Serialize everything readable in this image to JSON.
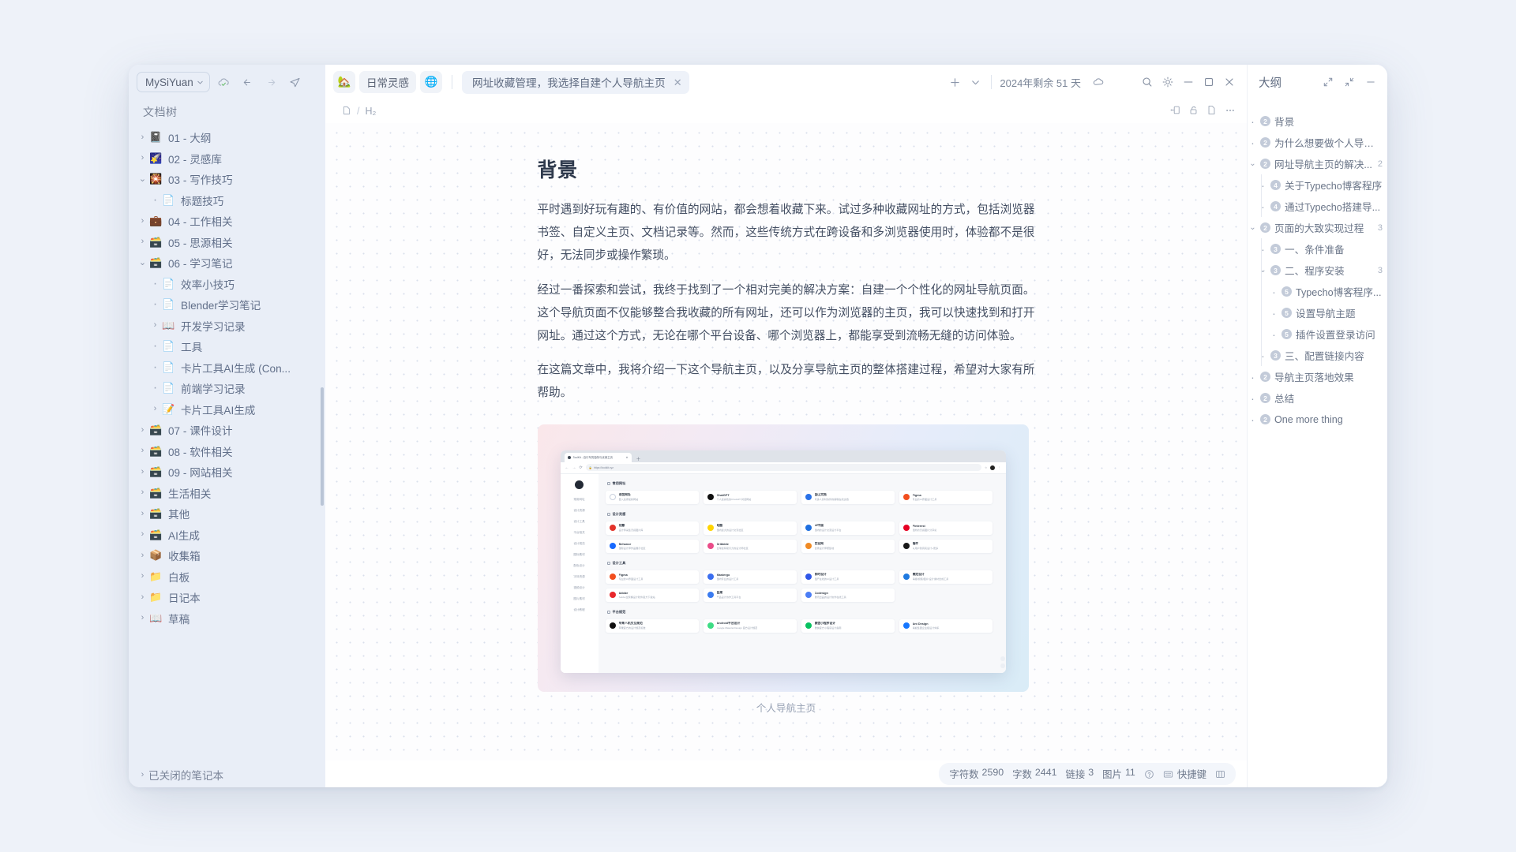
{
  "sidebar": {
    "workspace": {
      "label": "MySiYuan",
      "chevron": "chevron-down-icon"
    },
    "toolbar_icons": [
      "cloud-sync-icon",
      "back-arrow-icon",
      "forward-arrow-icon",
      "send-plane-icon"
    ],
    "section_title": "文档树",
    "items": [
      {
        "label": "01 - 大纲",
        "emoji": "📓",
        "twisty": "collapsed",
        "indent": 0
      },
      {
        "label": "02 - 灵感库",
        "emoji": "🌠",
        "twisty": "collapsed",
        "indent": 0
      },
      {
        "label": "03 - 写作技巧",
        "emoji": "🎇",
        "twisty": "expanded",
        "indent": 0
      },
      {
        "label": "标题技巧",
        "emoji": "📄",
        "twisty": "dot",
        "indent": 1
      },
      {
        "label": "04 - 工作相关",
        "emoji": "💼",
        "twisty": "collapsed",
        "indent": 0
      },
      {
        "label": "05 - 思源相关",
        "emoji": "🗃️",
        "twisty": "collapsed",
        "indent": 0
      },
      {
        "label": "06 - 学习笔记",
        "emoji": "🗃️",
        "twisty": "expanded",
        "indent": 0
      },
      {
        "label": "效率小技巧",
        "emoji": "📄",
        "twisty": "dot",
        "indent": 1
      },
      {
        "label": "Blender学习笔记",
        "emoji": "📄",
        "twisty": "dot",
        "indent": 1
      },
      {
        "label": "开发学习记录",
        "emoji": "📖",
        "twisty": "collapsed",
        "indent": 1
      },
      {
        "label": "工具",
        "emoji": "📄",
        "twisty": "dot",
        "indent": 1
      },
      {
        "label": "卡片工具AI生成 (Con...",
        "emoji": "📄",
        "twisty": "dot",
        "indent": 1
      },
      {
        "label": "前端学习记录",
        "emoji": "📄",
        "twisty": "dot",
        "indent": 1
      },
      {
        "label": "卡片工具AI生成",
        "emoji": "📝",
        "twisty": "collapsed",
        "indent": 1
      },
      {
        "label": "07 - 课件设计",
        "emoji": "🗃️",
        "twisty": "collapsed",
        "indent": 0
      },
      {
        "label": "08 - 软件相关",
        "emoji": "🗃️",
        "twisty": "collapsed",
        "indent": 0
      },
      {
        "label": "09 - 网站相关",
        "emoji": "🗃️",
        "twisty": "collapsed",
        "indent": 0
      },
      {
        "label": "生活相关",
        "emoji": "🗃️",
        "twisty": "collapsed",
        "indent": 0
      },
      {
        "label": "其他",
        "emoji": "🗃️",
        "twisty": "collapsed",
        "indent": 0
      },
      {
        "label": "AI生成",
        "emoji": "🗃️",
        "twisty": "collapsed",
        "indent": 0
      },
      {
        "label": "收集箱",
        "emoji": "📦",
        "twisty": "collapsed",
        "indent": 0
      },
      {
        "label": "白板",
        "emoji": "📁",
        "twisty": "collapsed",
        "indent": 0
      },
      {
        "label": "日记本",
        "emoji": "📁",
        "twisty": "collapsed",
        "indent": 0
      },
      {
        "label": "草稿",
        "emoji": "📖",
        "twisty": "collapsed",
        "indent": 0
      }
    ],
    "closed_notebooks": "已关闭的笔记本"
  },
  "tabbar": {
    "pinned": [
      {
        "label": "",
        "icon": "house-icon",
        "glyph": "🏡"
      },
      {
        "label": "日常灵感",
        "icon": "",
        "glyph": ""
      },
      {
        "label": "",
        "icon": "globe-icon",
        "glyph": "🌐"
      }
    ],
    "active_tab": {
      "title": "网址收藏管理，我选择自建个人导航主页",
      "close": "close-icon"
    },
    "add_tab": "+",
    "tab_menu": "chevron-down-icon",
    "year_remaining": "2024年剩余 51 天",
    "cloud_icon": "cloud-icon",
    "window_controls": [
      "search-icon",
      "theme-sun-icon",
      "minimize-icon",
      "maximize-icon",
      "close-icon"
    ]
  },
  "breadcrumb": {
    "doc_icon": "document-icon",
    "separator": "/",
    "heading_level": "H₂",
    "right_icons": [
      "outline-toggle-icon",
      "unlock-icon",
      "page-icon",
      "more-dots-icon"
    ]
  },
  "document": {
    "heading": "背景",
    "paragraphs": [
      "平时遇到好玩有趣的、有价值的网站，都会想着收藏下来。试过多种收藏网址的方式，包括浏览器书签、自定义主页、文档记录等。然而，这些传统方式在跨设备和多浏览器使用时，体验都不是很好，无法同步或操作繁琐。",
      "经过一番探索和尝试，我终于找到了一个相对完美的解决方案：自建一个个性化的网址导航页面。这个导航页面不仅能够整合我收藏的所有网址，还可以作为浏览器的主页，我可以快速找到和打开网址。通过这个方式，无论在哪个平台设备、哪个浏览器上，都能享受到流畅无缝的访问体验。",
      "在这篇文章中，我将介绍一下这个导航主页，以及分享导航主页的整体搭建过程，希望对大家有所帮助。"
    ],
    "figure_caption": "个人导航主页"
  },
  "mock_browser": {
    "tab_title": "ToolKit - 自行车的独特与优美主页",
    "url": "https://toolkit.xyz",
    "sidebar_nav": [
      "常用网址",
      "设计资源",
      "设计工具",
      "平台相关",
      "设计规范",
      "图标素材",
      "配色设计",
      "字体资源",
      "视频设计",
      "图片素材",
      "设计教程"
    ],
    "sections": [
      {
        "title": "常用网址",
        "cards": [
          {
            "name": "添加网址",
            "desc": "登入后添加新网站",
            "color": "#ffffff",
            "border": true
          },
          {
            "name": "ChatGPT",
            "desc": "个人最喜欢的ChatGPT对话网站",
            "color": "#0f0f0f"
          },
          {
            "name": "金山文档",
            "desc": "可多人实时协作的编辑在线文档",
            "color": "#2a72e8"
          },
          {
            "name": "Figma",
            "desc": "专业的UI界面设计工具",
            "color": "#f24e1e"
          }
        ]
      },
      {
        "title": "设计灵感",
        "cards": [
          {
            "name": "花瓣",
            "desc": "设计师采集灵感图片库",
            "color": "#e3332a"
          },
          {
            "name": "站酷",
            "desc": "国内最大的设计交流社区",
            "color": "#ffd400"
          },
          {
            "name": "UI中国",
            "desc": "国内的设计交流设计平台",
            "color": "#1f6fe0"
          },
          {
            "name": "Pinterest",
            "desc": "国外的灵感图片分享站",
            "color": "#e60023"
          },
          {
            "name": "Behance",
            "desc": "国际设计师作品展示社区",
            "color": "#1769ff"
          },
          {
            "name": "Dribbble",
            "desc": "全球最有吸引力的设计师社区",
            "color": "#ea4c89"
          },
          {
            "name": "优设网",
            "desc": "优秀设计师聚集地",
            "color": "#f08a24"
          },
          {
            "name": "插件",
            "desc": "从用户到真实设计+更多",
            "color": "#1a1a1a"
          }
        ]
      },
      {
        "title": "设计工具",
        "cards": [
          {
            "name": "Figma",
            "desc": "专业的UI界面设计工具",
            "color": "#f24e1e"
          },
          {
            "name": "Mastergo",
            "desc": "国内专业的设计工具",
            "color": "#3b6ef0"
          },
          {
            "name": "即时设计",
            "desc": "国产在线的UI设计工具",
            "color": "#2f57e8"
          },
          {
            "name": "稿定设计",
            "desc": "海报/视频/图片/设计素材合成工具",
            "color": "#1f7ae0"
          },
          {
            "name": "Adobe",
            "desc": "Adobe全家桶设计软件官方下载站",
            "color": "#e8262b"
          },
          {
            "name": "蓝湖",
            "desc": "产品设计协作工具平台",
            "color": "#3a7bf0"
          },
          {
            "name": "Codesign",
            "desc": "腾讯出品的设计协作在线工具",
            "color": "#4a7df5"
          }
        ]
      },
      {
        "title": "平台规范",
        "cards": [
          {
            "name": "苹果人机交互规范",
            "desc": "苹果官方的设计规范标准",
            "color": "#111111"
          },
          {
            "name": "Android平台设计",
            "desc": "Google Material Design 官方设计规范",
            "color": "#3ddc84"
          },
          {
            "name": "微信小程序设计",
            "desc": "微信官方小程序设计指南",
            "color": "#07c160"
          },
          {
            "name": "Ant Design",
            "desc": "蚂蚁集团企业级设计体系",
            "color": "#1677ff"
          }
        ]
      }
    ]
  },
  "statusbar": {
    "chars_label": "字符数",
    "chars_value": "2590",
    "words_label": "字数",
    "words_value": "2441",
    "links_label": "链接",
    "links_value": "3",
    "images_label": "图片",
    "images_value": "11",
    "help_icon": "help-circle-icon",
    "keyboard_icon": "keyboard-icon",
    "keyboard_label": "快捷键",
    "layout_icon": "columns-icon"
  },
  "outline": {
    "title": "大纲",
    "header_icons": [
      "expand-all-icon",
      "collapse-all-icon",
      "minimize-icon"
    ],
    "items": [
      {
        "label": "背景",
        "level": 2,
        "indent": 0,
        "twisty": "dot",
        "count": ""
      },
      {
        "label": "为什么想要做个人导航主页",
        "level": 2,
        "indent": 0,
        "twisty": "dot",
        "count": ""
      },
      {
        "label": "网址导航主页的解决...",
        "level": 2,
        "indent": 0,
        "twisty": "expanded",
        "count": "2"
      },
      {
        "label": "关于Typecho博客程序",
        "level": 4,
        "indent": 1,
        "twisty": "dot",
        "count": ""
      },
      {
        "label": "通过Typecho搭建导...",
        "level": 4,
        "indent": 1,
        "twisty": "dot",
        "count": ""
      },
      {
        "label": "页面的大致实现过程",
        "level": 2,
        "indent": 0,
        "twisty": "expanded",
        "count": "3"
      },
      {
        "label": "一、条件准备",
        "level": 3,
        "indent": 1,
        "twisty": "dot",
        "count": ""
      },
      {
        "label": "二、程序安装",
        "level": 3,
        "indent": 1,
        "twisty": "expanded",
        "count": "3"
      },
      {
        "label": "Typecho博客程序...",
        "level": 5,
        "indent": 2,
        "twisty": "dot",
        "count": ""
      },
      {
        "label": "设置导航主题",
        "level": 5,
        "indent": 2,
        "twisty": "dot",
        "count": ""
      },
      {
        "label": "插件设置登录访问",
        "level": 5,
        "indent": 2,
        "twisty": "dot",
        "count": ""
      },
      {
        "label": "三、配置链接内容",
        "level": 3,
        "indent": 1,
        "twisty": "dot",
        "count": ""
      },
      {
        "label": "导航主页落地效果",
        "level": 2,
        "indent": 0,
        "twisty": "dot",
        "count": ""
      },
      {
        "label": "总结",
        "level": 2,
        "indent": 0,
        "twisty": "dot",
        "count": ""
      },
      {
        "label": "One more thing",
        "level": 2,
        "indent": 0,
        "twisty": "dot",
        "count": ""
      }
    ]
  },
  "colors": {
    "app_bg": "#eef2f9",
    "sidebar_bg": "#e9eef7",
    "text": "#62708a",
    "accent": "#4a7df5"
  }
}
